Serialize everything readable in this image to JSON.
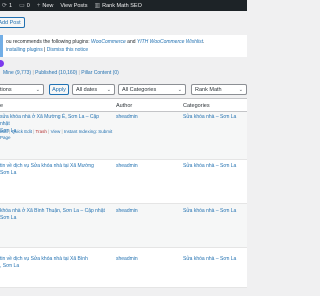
{
  "adminbar": {
    "items": [
      {
        "icon": "plus-icon",
        "label": "1"
      },
      {
        "icon": "comment-icon",
        "label": "0"
      },
      {
        "icon": "plus-icon",
        "label": "New"
      },
      {
        "icon": "",
        "label": "View Posts"
      },
      {
        "icon": "",
        "label": "Rank Math SEO"
      }
    ]
  },
  "add_post_label": "Add Post",
  "notice": {
    "text_before": "ou recommends the following plugins: ",
    "plugin1": "WooCommerce",
    "and": " and ",
    "plugin2": "YITH WooCommerce Wishlist",
    "text_after": ".",
    "link_install": "installing plugins",
    "sep": " | ",
    "link_dismiss": "Dismiss this notice"
  },
  "statuses": {
    "all": "Mine (9,773)",
    "published": "Published (10,160)",
    "cornerstone": "Pillar Content (0)",
    "sep": "|"
  },
  "filters": {
    "bulk_action": "tions",
    "apply": "Apply",
    "dates": "All dates",
    "categories": "All Categories",
    "rank_math": "Rank Math"
  },
  "columns": {
    "title": "e",
    "author": "Author",
    "categories": "Categories"
  },
  "rows": [
    {
      "title_line1": "sửa khóa nhà ở Xã Mường É, Sơn La – Cập nhật",
      "title_line2": "Sơn La",
      "actions": {
        "edit": "Edit",
        "quick": "Quick Edit",
        "trash": "Trash",
        "view": "View",
        "instant": "Instant Indexing: Submit",
        "page": "Page"
      },
      "author": "sheadmin",
      "category": "Sửa khóa nhà – Sơn La"
    },
    {
      "title_line1": "tin về dịch vụ Sửa khóa nhà tại Xã Mường",
      "title_line2": "Sơn La",
      "author": "sheadmin",
      "category": "Sửa khóa nhà – Sơn La"
    },
    {
      "title_line1": "khóa nhà ở Xã Bình Thuận, Sơn La – Cập nhật",
      "title_line2": "Sơn La",
      "author": "sheadmin",
      "category": "Sửa khóa nhà – Sơn La"
    },
    {
      "title_line1": "tin về dịch vụ Sửa khóa nhà tại Xã Bình",
      "title_line2": ", Sơn La",
      "author": "sheadmin",
      "category": "Sửa khóa nhà – Sơn La"
    }
  ]
}
